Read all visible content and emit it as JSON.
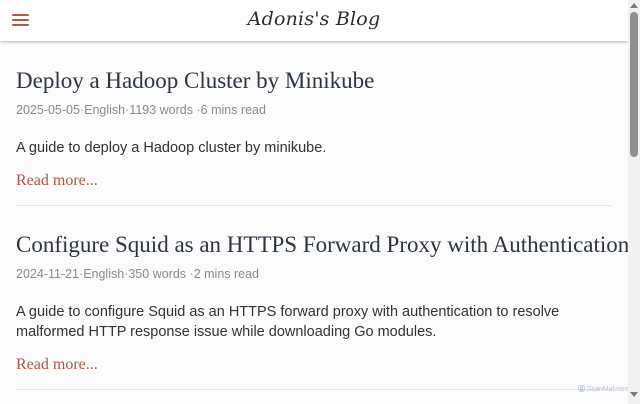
{
  "header": {
    "site_title": "Adonis's Blog",
    "menu_icon": "hamburger-menu-icon"
  },
  "posts": [
    {
      "title": "Deploy a Hadoop Cluster by Minikube",
      "date": "2025-05-05",
      "language": "English",
      "words": "1193 words",
      "read_time": "6 mins read",
      "excerpt": "A guide to deploy a Hadoop cluster by minikube.",
      "read_more": "Read more..."
    },
    {
      "title": "Configure Squid as an HTTPS Forward Proxy with Authentication",
      "date": "2024-11-21",
      "language": "English",
      "words": "350 words",
      "read_time": "2 mins read",
      "excerpt": "A guide to configure Squid as an HTTPS forward proxy with authentication to resolve malformed HTTP response issue while downloading Go modules.",
      "read_more": "Read more..."
    }
  ],
  "meta_separator": "·",
  "watermark": {
    "mark": "ⓖ",
    "text": "ScanMalware"
  },
  "colors": {
    "accent": "#b0564c",
    "title_text": "#2c3540",
    "meta_text": "#8a8a8a",
    "background": "#fbfbfb"
  }
}
